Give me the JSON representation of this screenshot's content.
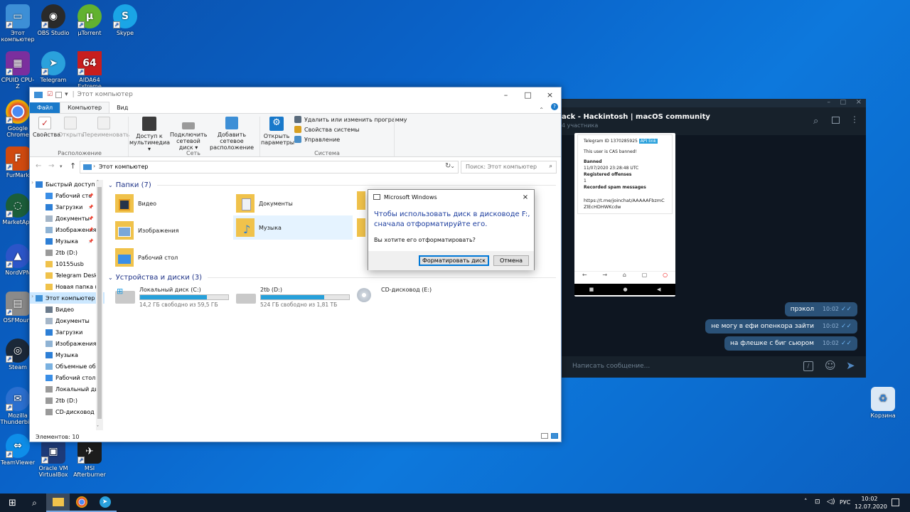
{
  "desktop": {
    "icons": [
      {
        "label": "Этот компьютер",
        "color": "#3d8fd6",
        "glyph": "▭"
      },
      {
        "label": "OBS Studio",
        "color": "#2a2a2a",
        "glyph": "◉"
      },
      {
        "label": "µTorrent",
        "color": "#62b22f",
        "glyph": "µ"
      },
      {
        "label": "Skype",
        "color": "#1aa5e6",
        "glyph": "S"
      },
      {
        "label": "CPUID CPU-Z",
        "color": "#7b2f9e",
        "glyph": "▦"
      },
      {
        "label": "Telegram",
        "color": "#2aa1dc",
        "glyph": "➤"
      },
      {
        "label": "AIDA64 Extreme",
        "color": "#c81e1e",
        "glyph": "64"
      },
      {
        "label": "Google Chrome",
        "color": "#e8e8e8",
        "glyph": "◕"
      },
      {
        "label": "FurMark",
        "color": "#d04a10",
        "glyph": "F"
      },
      {
        "label": "MarketApp",
        "color": "#1b5e3a",
        "glyph": "◌"
      },
      {
        "label": "NordVPN",
        "color": "#2c55c8",
        "glyph": "▲"
      },
      {
        "label": "OSFMount",
        "color": "#8a8a8a",
        "glyph": "▤"
      },
      {
        "label": "Steam",
        "color": "#1b2838",
        "glyph": "◎"
      },
      {
        "label": "Mozilla Thunderbird",
        "color": "#2b6fcf",
        "glyph": "✉"
      },
      {
        "label": "TeamViewer",
        "color": "#0e8ee9",
        "glyph": "⇔"
      },
      {
        "label": "Oracle VM VirtualBox",
        "color": "#1d3a78",
        "glyph": "▣"
      },
      {
        "label": "MSI Afterburner",
        "color": "#1c1c1c",
        "glyph": "✈"
      },
      {
        "label": "Корзина",
        "color": "#dbe8f5",
        "glyph": "♻"
      }
    ]
  },
  "telegram": {
    "title": "ack - Hackintosh | macOS community",
    "subtitle": "4 участника",
    "card": {
      "header": "Telegram ID 1370285925",
      "api_link": "API link",
      "cas": "This user is CAS banned!",
      "banned_label": "Banned",
      "banned_date": "11/07/2020 23:28:48 UTC",
      "offenses_label": "Registered offenses",
      "offenses_value": "1",
      "spam_label": "Recorded spam messages",
      "link": "https://t.me/joinchat/AAAAAFbzmCZlEcHDHWKcdw"
    },
    "messages": [
      {
        "text": "прэкол",
        "time": "10:02"
      },
      {
        "text": "не могу в ефи опенкора зайти",
        "time": "10:02"
      },
      {
        "text": "на флешке с биг сьюром",
        "time": "10:02"
      }
    ],
    "input_placeholder": "Написать сообщение..."
  },
  "explorer": {
    "title": "Этот компьютер",
    "tabs": {
      "file": "Файл",
      "computer": "Компьютер",
      "view": "Вид"
    },
    "ribbon": {
      "properties": "Свойства",
      "open": "Открыть",
      "rename": "Переименовать",
      "group_location": "Расположение",
      "media_access": "Доступ к мультимедиа",
      "map_drive": "Подключить сетевой диск",
      "add_location": "Добавить сетевое расположение",
      "group_network": "Сеть",
      "open_settings": "Открыть параметры",
      "uninstall": "Удалить или изменить программу",
      "system_props": "Свойства системы",
      "manage": "Управление",
      "group_system": "Система"
    },
    "address": "Этот компьютер",
    "search_placeholder": "Поиск: Этот компьютер",
    "nav": [
      {
        "label": "Быстрый доступ",
        "pin": false,
        "indent": 0,
        "color": "#2d7fd6"
      },
      {
        "label": "Рабочий сто",
        "pin": true,
        "indent": 1,
        "color": "#3a8ee6"
      },
      {
        "label": "Загрузки",
        "pin": true,
        "indent": 1,
        "color": "#2d7fd6"
      },
      {
        "label": "Документы",
        "pin": true,
        "indent": 1,
        "color": "#a5b6c8"
      },
      {
        "label": "Изображения",
        "pin": true,
        "indent": 1,
        "color": "#8fb3d4"
      },
      {
        "label": "Музыка",
        "pin": true,
        "indent": 1,
        "color": "#2d7fd6"
      },
      {
        "label": "2tb (D:)",
        "pin": false,
        "indent": 1,
        "color": "#9a9a9a"
      },
      {
        "label": "10155usb",
        "pin": false,
        "indent": 1,
        "color": "#f0c24b"
      },
      {
        "label": "Telegram Deskto",
        "pin": false,
        "indent": 1,
        "color": "#f0c24b"
      },
      {
        "label": "Новая папка (2)",
        "pin": false,
        "indent": 1,
        "color": "#f0c24b"
      },
      {
        "label": "Этот компьютер",
        "pin": false,
        "indent": 0,
        "color": "#3d8fd6",
        "sel": true
      },
      {
        "label": "Видео",
        "pin": false,
        "indent": 1,
        "color": "#6b7b8c"
      },
      {
        "label": "Документы",
        "pin": false,
        "indent": 1,
        "color": "#a5b6c8"
      },
      {
        "label": "Загрузки",
        "pin": false,
        "indent": 1,
        "color": "#2d7fd6"
      },
      {
        "label": "Изображения",
        "pin": false,
        "indent": 1,
        "color": "#8fb3d4"
      },
      {
        "label": "Музыка",
        "pin": false,
        "indent": 1,
        "color": "#2d7fd6"
      },
      {
        "label": "Объемные объ",
        "pin": false,
        "indent": 1,
        "color": "#7ab1e0"
      },
      {
        "label": "Рабочий стол",
        "pin": false,
        "indent": 1,
        "color": "#3a8ee6"
      },
      {
        "label": "Локальный дис",
        "pin": false,
        "indent": 1,
        "color": "#9a9a9a"
      },
      {
        "label": "2tb (D:)",
        "pin": false,
        "indent": 1,
        "color": "#9a9a9a"
      },
      {
        "label": "CD-дисковод (E",
        "pin": false,
        "indent": 1,
        "color": "#9a9a9a"
      }
    ],
    "folders_header": "Папки (7)",
    "folders": [
      {
        "label": "Видео",
        "accent": "#26334a"
      },
      {
        "label": "Документы",
        "accent": "#d9e3ee"
      },
      {
        "label": "Изображения",
        "accent": "#7aa7d8"
      },
      {
        "label": "Музыка",
        "accent": "#2d7fd6"
      },
      {
        "label": "Рабочий стол",
        "accent": "#3a8ee6"
      }
    ],
    "drives_header": "Устройства и диски (3)",
    "drives": [
      {
        "label": "Локальный диск (C:)",
        "free": "14,2 ГБ свободно из 59,5 ГБ",
        "used": 0.76
      },
      {
        "label": "2tb (D:)",
        "free": "524 ГБ свободно из 1,81 ТБ",
        "used": 0.72
      },
      {
        "label": "CD-дисковод (E:)",
        "free": "",
        "used": null
      }
    ],
    "status": "Элементов: 10"
  },
  "dialog": {
    "title": "Microsoft Windows",
    "message": "Чтобы использовать диск в дисководе F:, сначала отформатируйте его.",
    "question": "Вы хотите его отформатировать?",
    "format_button": "Форматировать диск",
    "cancel_button": "Отмена"
  },
  "taskbar": {
    "lang": "РУС",
    "time": "10:02",
    "date": "12.07.2020"
  },
  "colors": {
    "accent": "#0078d7",
    "telegram_bg": "#0e1621",
    "bubble": "#2b5278"
  }
}
